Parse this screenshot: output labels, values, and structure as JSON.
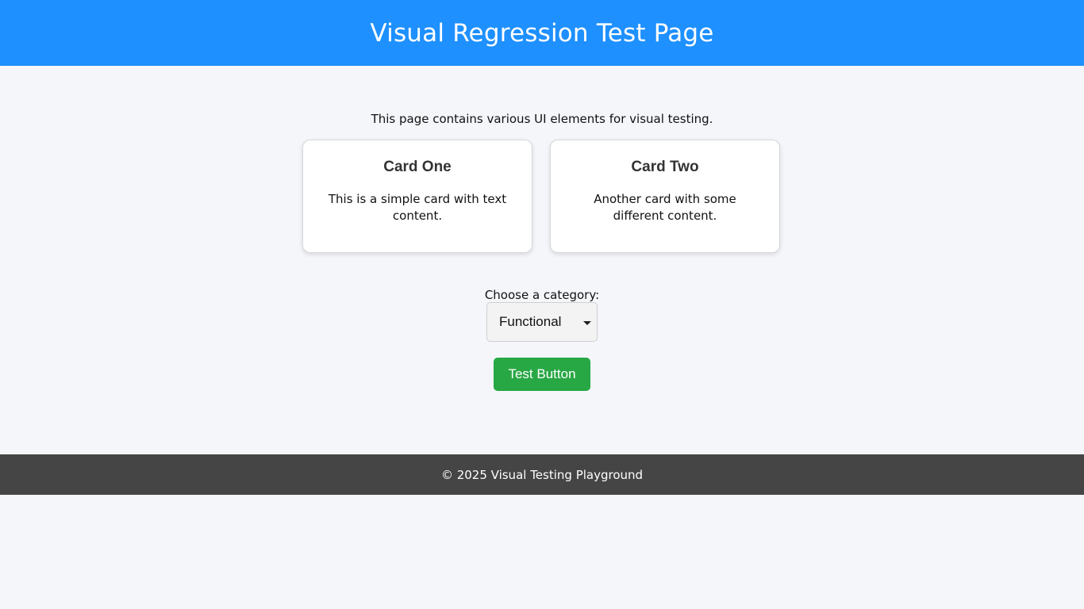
{
  "header": {
    "title": "Visual Regression Test Page",
    "background_color": "#1e90ff"
  },
  "intro": {
    "text": "This page contains various UI elements for visual testing."
  },
  "cards": [
    {
      "title": "Card One",
      "body": "This is a simple card with text content."
    },
    {
      "title": "Card Two",
      "body": "Another card with some different content."
    }
  ],
  "category": {
    "label": "Choose a category:",
    "selected": "Functional",
    "icon": "chevron-down-icon"
  },
  "button": {
    "label": "Test Button",
    "color": "#28a745"
  },
  "footer": {
    "text": "© 2025 Visual Testing Playground",
    "background_color": "#454545"
  }
}
